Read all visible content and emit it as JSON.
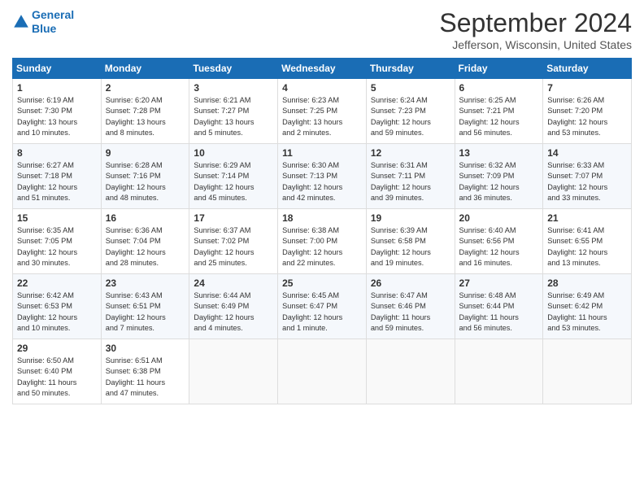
{
  "header": {
    "logo_line1": "General",
    "logo_line2": "Blue",
    "month_title": "September 2024",
    "location": "Jefferson, Wisconsin, United States"
  },
  "weekdays": [
    "Sunday",
    "Monday",
    "Tuesday",
    "Wednesday",
    "Thursday",
    "Friday",
    "Saturday"
  ],
  "weeks": [
    [
      {
        "day": "1",
        "info": "Sunrise: 6:19 AM\nSunset: 7:30 PM\nDaylight: 13 hours\nand 10 minutes."
      },
      {
        "day": "2",
        "info": "Sunrise: 6:20 AM\nSunset: 7:28 PM\nDaylight: 13 hours\nand 8 minutes."
      },
      {
        "day": "3",
        "info": "Sunrise: 6:21 AM\nSunset: 7:27 PM\nDaylight: 13 hours\nand 5 minutes."
      },
      {
        "day": "4",
        "info": "Sunrise: 6:23 AM\nSunset: 7:25 PM\nDaylight: 13 hours\nand 2 minutes."
      },
      {
        "day": "5",
        "info": "Sunrise: 6:24 AM\nSunset: 7:23 PM\nDaylight: 12 hours\nand 59 minutes."
      },
      {
        "day": "6",
        "info": "Sunrise: 6:25 AM\nSunset: 7:21 PM\nDaylight: 12 hours\nand 56 minutes."
      },
      {
        "day": "7",
        "info": "Sunrise: 6:26 AM\nSunset: 7:20 PM\nDaylight: 12 hours\nand 53 minutes."
      }
    ],
    [
      {
        "day": "8",
        "info": "Sunrise: 6:27 AM\nSunset: 7:18 PM\nDaylight: 12 hours\nand 51 minutes."
      },
      {
        "day": "9",
        "info": "Sunrise: 6:28 AM\nSunset: 7:16 PM\nDaylight: 12 hours\nand 48 minutes."
      },
      {
        "day": "10",
        "info": "Sunrise: 6:29 AM\nSunset: 7:14 PM\nDaylight: 12 hours\nand 45 minutes."
      },
      {
        "day": "11",
        "info": "Sunrise: 6:30 AM\nSunset: 7:13 PM\nDaylight: 12 hours\nand 42 minutes."
      },
      {
        "day": "12",
        "info": "Sunrise: 6:31 AM\nSunset: 7:11 PM\nDaylight: 12 hours\nand 39 minutes."
      },
      {
        "day": "13",
        "info": "Sunrise: 6:32 AM\nSunset: 7:09 PM\nDaylight: 12 hours\nand 36 minutes."
      },
      {
        "day": "14",
        "info": "Sunrise: 6:33 AM\nSunset: 7:07 PM\nDaylight: 12 hours\nand 33 minutes."
      }
    ],
    [
      {
        "day": "15",
        "info": "Sunrise: 6:35 AM\nSunset: 7:05 PM\nDaylight: 12 hours\nand 30 minutes."
      },
      {
        "day": "16",
        "info": "Sunrise: 6:36 AM\nSunset: 7:04 PM\nDaylight: 12 hours\nand 28 minutes."
      },
      {
        "day": "17",
        "info": "Sunrise: 6:37 AM\nSunset: 7:02 PM\nDaylight: 12 hours\nand 25 minutes."
      },
      {
        "day": "18",
        "info": "Sunrise: 6:38 AM\nSunset: 7:00 PM\nDaylight: 12 hours\nand 22 minutes."
      },
      {
        "day": "19",
        "info": "Sunrise: 6:39 AM\nSunset: 6:58 PM\nDaylight: 12 hours\nand 19 minutes."
      },
      {
        "day": "20",
        "info": "Sunrise: 6:40 AM\nSunset: 6:56 PM\nDaylight: 12 hours\nand 16 minutes."
      },
      {
        "day": "21",
        "info": "Sunrise: 6:41 AM\nSunset: 6:55 PM\nDaylight: 12 hours\nand 13 minutes."
      }
    ],
    [
      {
        "day": "22",
        "info": "Sunrise: 6:42 AM\nSunset: 6:53 PM\nDaylight: 12 hours\nand 10 minutes."
      },
      {
        "day": "23",
        "info": "Sunrise: 6:43 AM\nSunset: 6:51 PM\nDaylight: 12 hours\nand 7 minutes."
      },
      {
        "day": "24",
        "info": "Sunrise: 6:44 AM\nSunset: 6:49 PM\nDaylight: 12 hours\nand 4 minutes."
      },
      {
        "day": "25",
        "info": "Sunrise: 6:45 AM\nSunset: 6:47 PM\nDaylight: 12 hours\nand 1 minute."
      },
      {
        "day": "26",
        "info": "Sunrise: 6:47 AM\nSunset: 6:46 PM\nDaylight: 11 hours\nand 59 minutes."
      },
      {
        "day": "27",
        "info": "Sunrise: 6:48 AM\nSunset: 6:44 PM\nDaylight: 11 hours\nand 56 minutes."
      },
      {
        "day": "28",
        "info": "Sunrise: 6:49 AM\nSunset: 6:42 PM\nDaylight: 11 hours\nand 53 minutes."
      }
    ],
    [
      {
        "day": "29",
        "info": "Sunrise: 6:50 AM\nSunset: 6:40 PM\nDaylight: 11 hours\nand 50 minutes."
      },
      {
        "day": "30",
        "info": "Sunrise: 6:51 AM\nSunset: 6:38 PM\nDaylight: 11 hours\nand 47 minutes."
      },
      {
        "day": "",
        "info": ""
      },
      {
        "day": "",
        "info": ""
      },
      {
        "day": "",
        "info": ""
      },
      {
        "day": "",
        "info": ""
      },
      {
        "day": "",
        "info": ""
      }
    ]
  ]
}
